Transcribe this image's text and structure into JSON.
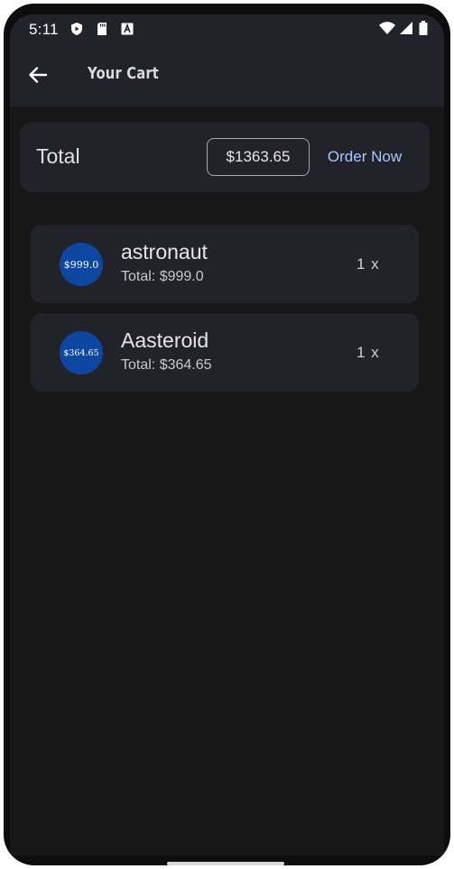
{
  "status_bar": {
    "time": "5:11",
    "icons_left": [
      "play-protect-icon",
      "sd-card-icon",
      "accessibility-a-icon"
    ],
    "icons_right": [
      "wifi-icon",
      "signal-icon",
      "battery-icon"
    ]
  },
  "app_bar": {
    "title": "Your Cart",
    "back_icon": "arrow-left-icon"
  },
  "summary": {
    "total_label": "Total",
    "total_amount": "$1363.65",
    "order_label": "Order Now"
  },
  "items": [
    {
      "avatar_text": "$999.0",
      "name": "astronaut",
      "total": "Total: $999.0",
      "qty": "1 x"
    },
    {
      "avatar_text": "$364.65",
      "name": "Aasteroid",
      "total": "Total: $364.65",
      "qty": "1 x"
    }
  ],
  "colors": {
    "background": "#171717",
    "surface": "#22232a",
    "accent_text": "#a9c7ff",
    "avatar": "#0d47a1"
  }
}
